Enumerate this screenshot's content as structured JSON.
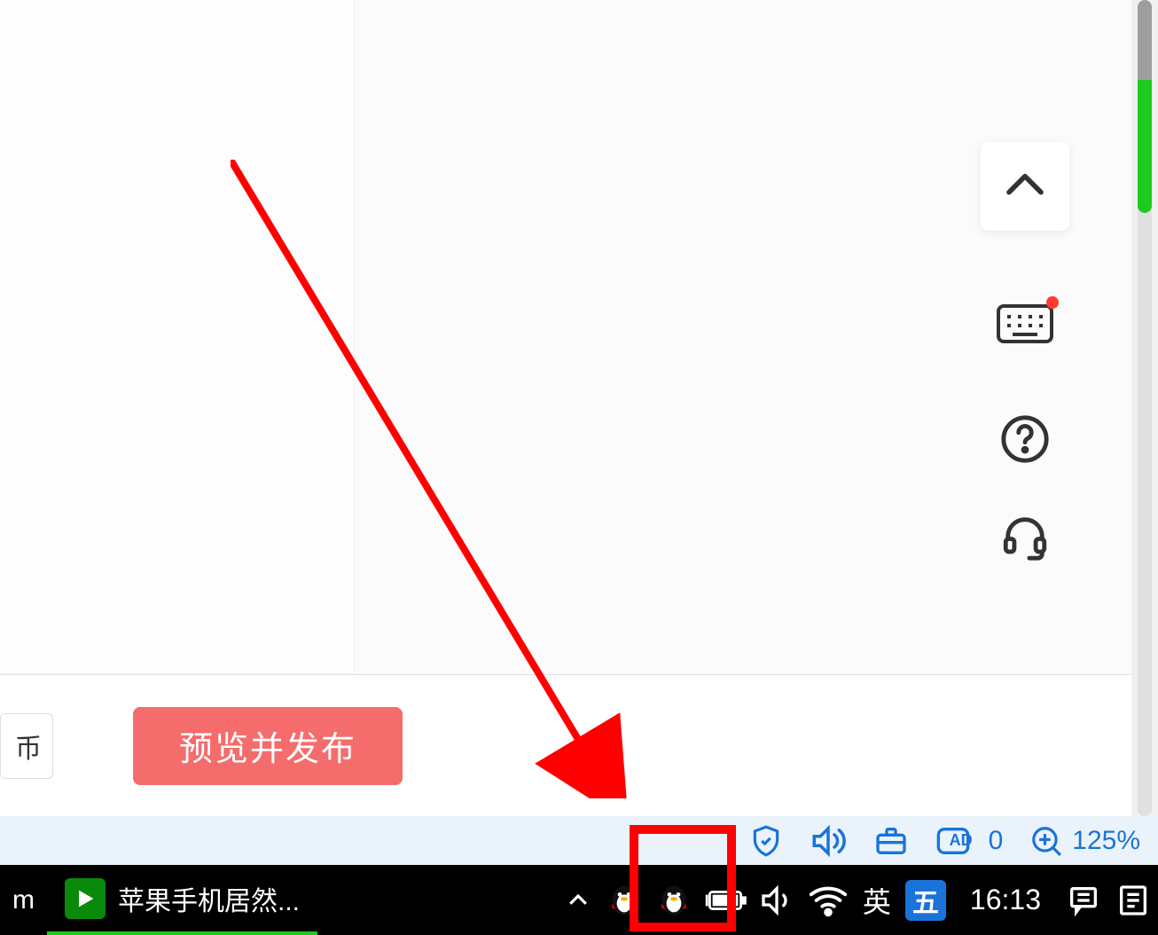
{
  "app": {
    "secondary_button_suffix": "币",
    "primary_button_label": "预览并发布"
  },
  "float_tools": {
    "collapse": "collapse-up",
    "keyboard": "keyboard",
    "help": "help",
    "headset": "support-headset"
  },
  "status_bar": {
    "shield": "security-shield",
    "volume": "volume",
    "toolbox": "extensions",
    "ad_block_label": "AD",
    "ad_block_count": "0",
    "zoom_label": "125%"
  },
  "taskbar": {
    "left_fragment": "m",
    "running_app_label": "苹果手机居然...",
    "ime_lang_label": "英",
    "ime_box_label": "五",
    "clock": "16:13"
  },
  "annotation": {
    "type": "arrow-to-wifi-tray-icon",
    "color": "#ff0000"
  }
}
